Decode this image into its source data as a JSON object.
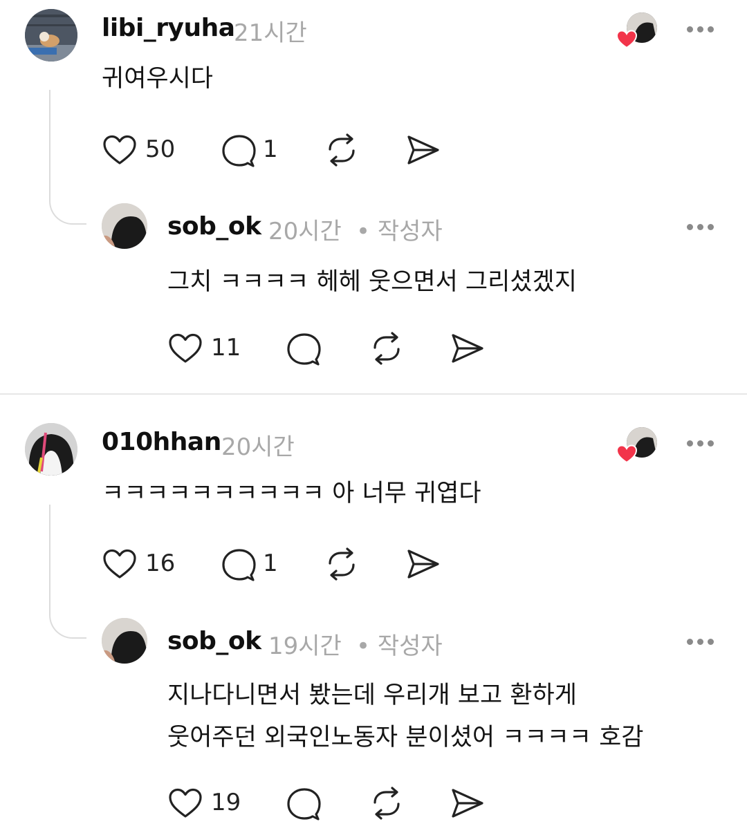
{
  "comments": [
    {
      "username": "libi_ryuha",
      "time": "21시간",
      "text": "귀여우시다",
      "likes": "50",
      "replies": "1",
      "avatar_colors": [
        "#5b6470",
        "#c98a52",
        "#3a6fb0"
      ],
      "reply": {
        "username": "sob_ok",
        "time": "20시간",
        "author_badge": "• 작성자",
        "lines": [
          "그치 ㅋㅋㅋㅋ 헤헤 웃으면서 그리셨겠지"
        ],
        "likes": "11"
      }
    },
    {
      "username": "010hhan",
      "time": "20시간",
      "text": "ㅋㅋㅋㅋㅋㅋㅋㅋㅋㅋ 아 너무 귀엽다",
      "likes": "16",
      "replies": "1",
      "avatar_colors": [
        "#1b1b1b",
        "#f2f2f2",
        "#e04a7a"
      ],
      "reply": {
        "username": "sob_ok",
        "time": "19시간",
        "author_badge": "• 작성자",
        "lines": [
          "지나다니면서 봤는데 우리개 보고 환하게",
          "웃어주던 외국인노동자 분이셨어 ㅋㅋㅋㅋ 호감"
        ],
        "likes": "19"
      }
    }
  ],
  "icons": {
    "like": "heart-outline-icon",
    "reply": "comment-bubble-icon",
    "repost": "repost-arrows-icon",
    "share": "send-paper-plane-icon",
    "more": "more-dots-icon",
    "liked_by_author": "author-avatar-with-red-heart-icon"
  },
  "colors": {
    "heart_badge": "#f2344a",
    "meta_text": "#a8a8a8",
    "thread_line": "#dcdcdc"
  }
}
